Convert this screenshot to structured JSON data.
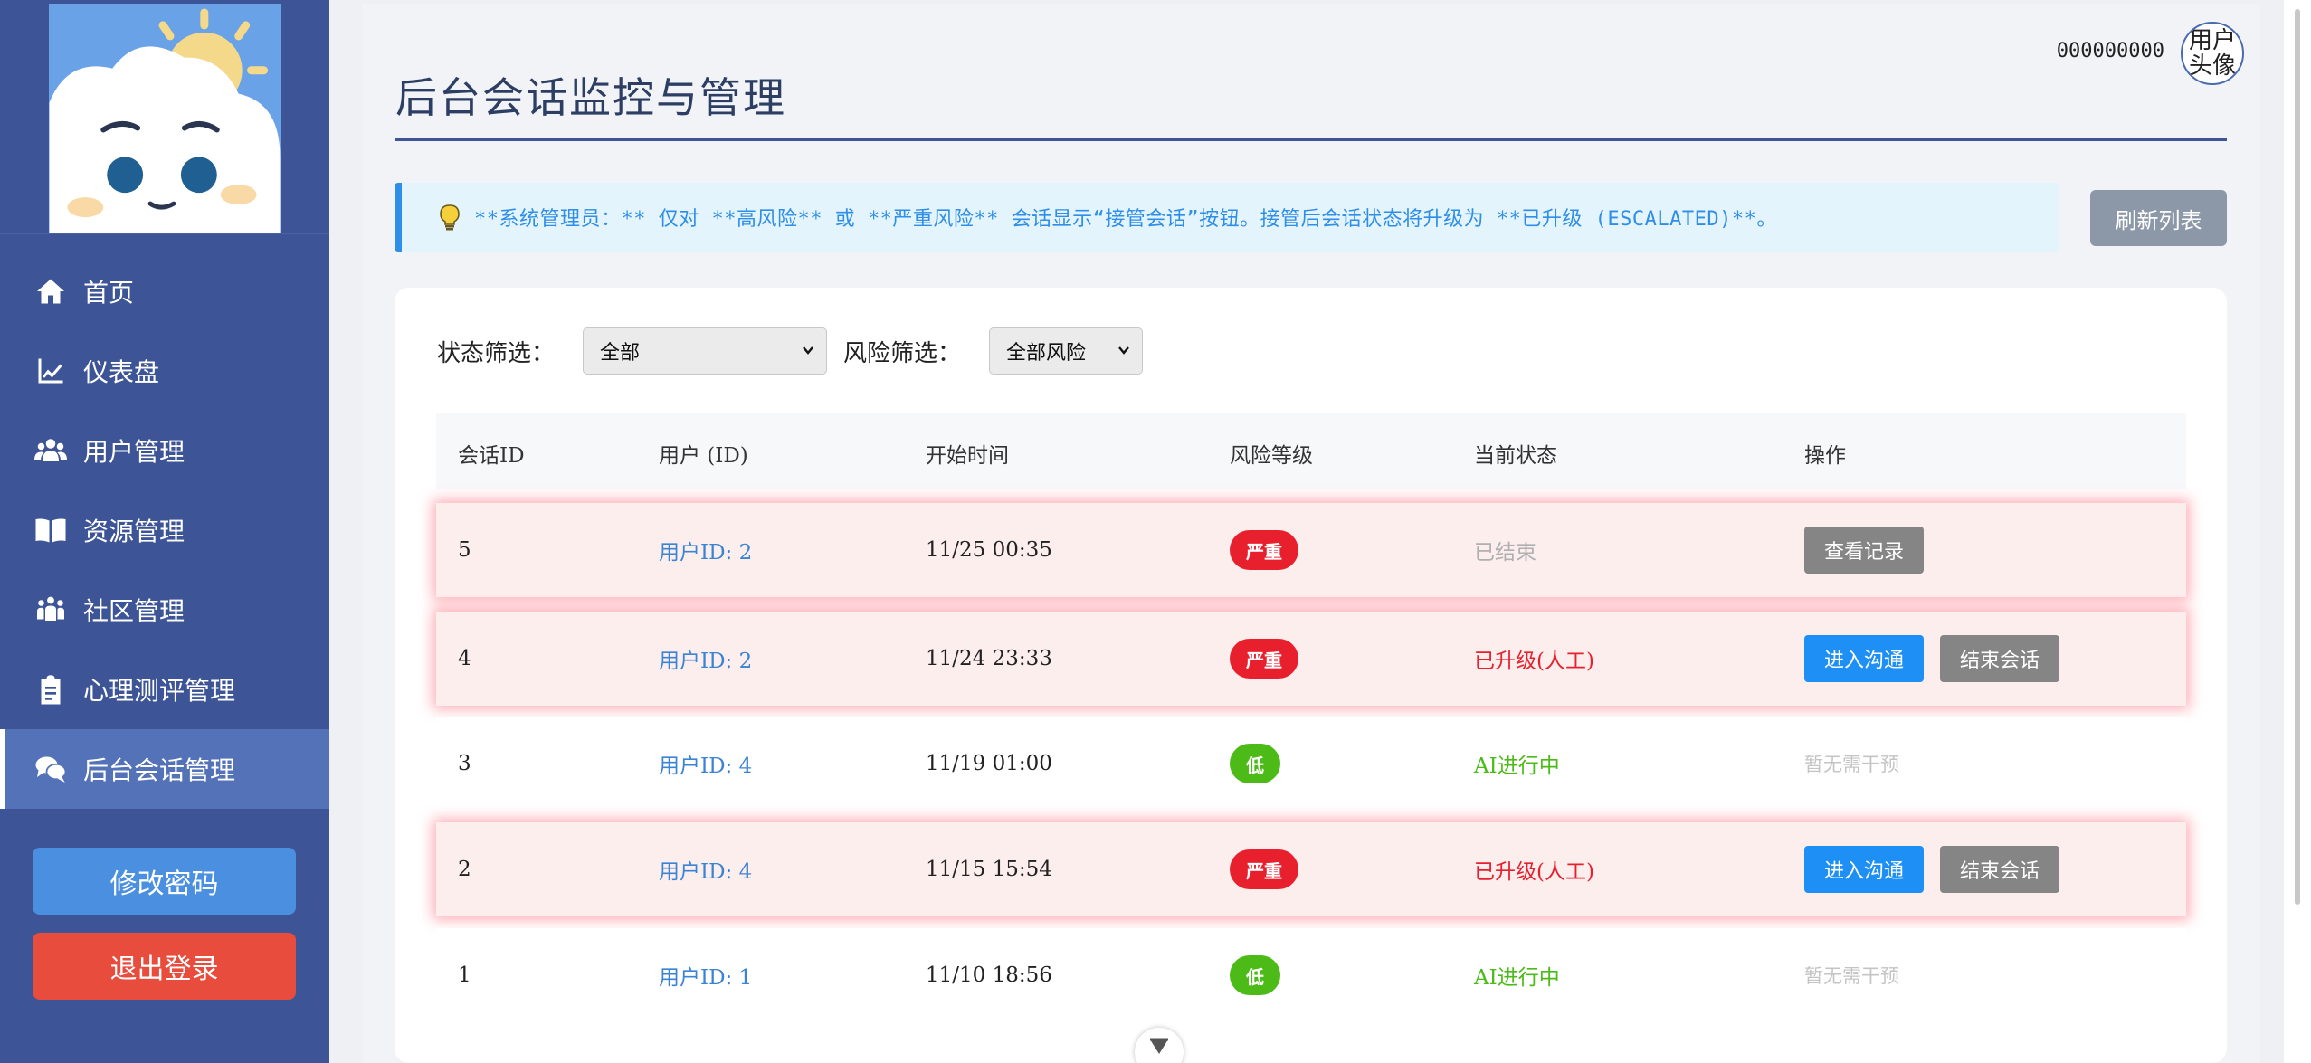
{
  "sidebar": {
    "items": [
      {
        "label": "首页",
        "icon": "home-icon"
      },
      {
        "label": "仪表盘",
        "icon": "chart-line-icon"
      },
      {
        "label": "用户管理",
        "icon": "users-icon"
      },
      {
        "label": "资源管理",
        "icon": "book-icon"
      },
      {
        "label": "社区管理",
        "icon": "community-icon"
      },
      {
        "label": "心理测评管理",
        "icon": "clipboard-icon"
      },
      {
        "label": "后台会话管理",
        "icon": "chat-icon"
      }
    ],
    "active_index": 6,
    "change_password_label": "修改密码",
    "logout_label": "退出登录"
  },
  "header": {
    "user_name": "000000000",
    "avatar_text": "用户头像"
  },
  "page": {
    "title": "后台会话监控与管理",
    "notice": "**系统管理员：** 仅对 **高风险** 或 **严重风险** 会话显示“接管会话”按钮。接管后会话状态将升级为 **已升级 (ESCALATED)**。",
    "refresh_label": "刷新列表"
  },
  "filters": {
    "status_label": "状态筛选：",
    "status_value": "全部",
    "risk_label": "风险筛选：",
    "risk_value": "全部风险"
  },
  "table": {
    "columns": [
      "会话ID",
      "用户 (ID)",
      "开始时间",
      "风险等级",
      "当前状态",
      "操作"
    ],
    "rows": [
      {
        "id": "5",
        "user": "用户ID: 2",
        "time": "11/25 00:35",
        "risk": "严重",
        "status": "已结束",
        "actions": [
          "查看记录"
        ]
      },
      {
        "id": "4",
        "user": "用户ID: 2",
        "time": "11/24 23:33",
        "risk": "严重",
        "status": "已升级(人工)",
        "actions": [
          "进入沟通",
          "结束会话"
        ]
      },
      {
        "id": "3",
        "user": "用户ID: 4",
        "time": "11/19 01:00",
        "risk": "低",
        "status": "AI进行中",
        "actions_text": "暂无需干预"
      },
      {
        "id": "2",
        "user": "用户ID: 4",
        "time": "11/15 15:54",
        "risk": "严重",
        "status": "已升级(人工)",
        "actions": [
          "进入沟通",
          "结束会话"
        ]
      },
      {
        "id": "1",
        "user": "用户ID: 1",
        "time": "11/10 18:56",
        "risk": "低",
        "status": "AI进行中",
        "actions_text": "暂无需干预"
      }
    ]
  },
  "colors": {
    "sidebar": "#3d5596",
    "accent_blue": "#1e90f5",
    "danger": "#e8202e",
    "success": "#4cbb17"
  }
}
